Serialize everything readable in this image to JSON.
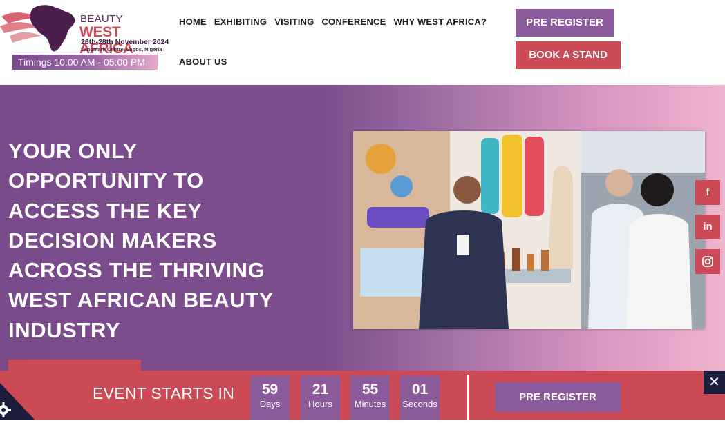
{
  "logo": {
    "line1": "BEAUTY",
    "line2": "WEST AFRICA",
    "dates": "26th-28th November 2024",
    "venue": "Landmark Centre, Lagos, Nigeria"
  },
  "timings": "Timings 10:00 AM - 05:00 PM",
  "nav": {
    "items": [
      "HOME",
      "EXHIBITING",
      "VISITING",
      "CONFERENCE",
      "WHY WEST AFRICA?"
    ],
    "about": "ABOUT US"
  },
  "header_buttons": {
    "pre_register": "PRE REGISTER",
    "book_stand": "BOOK A STAND"
  },
  "hero": {
    "headline": "YOUR ONLY OPPORTUNITY TO ACCESS THE KEY DECISION MAKERS ACROSS THE THRIVING WEST AFRICAN BEAUTY INDUSTRY"
  },
  "social": [
    {
      "icon": "facebook-icon",
      "glyph": "f"
    },
    {
      "icon": "linkedin-icon",
      "glyph": "in"
    },
    {
      "icon": "instagram-icon",
      "glyph": ""
    }
  ],
  "countdown": {
    "label": "EVENT STARTS IN",
    "units": [
      {
        "value": "59",
        "unit": "Days"
      },
      {
        "value": "21",
        "unit": "Hours"
      },
      {
        "value": "55",
        "unit": "Minutes"
      },
      {
        "value": "01",
        "unit": "Seconds"
      }
    ],
    "button": "PRE REGISTER"
  },
  "colors": {
    "purple": "#8a5a9a",
    "red": "#cc4a56",
    "dark": "#1b1d3a"
  }
}
